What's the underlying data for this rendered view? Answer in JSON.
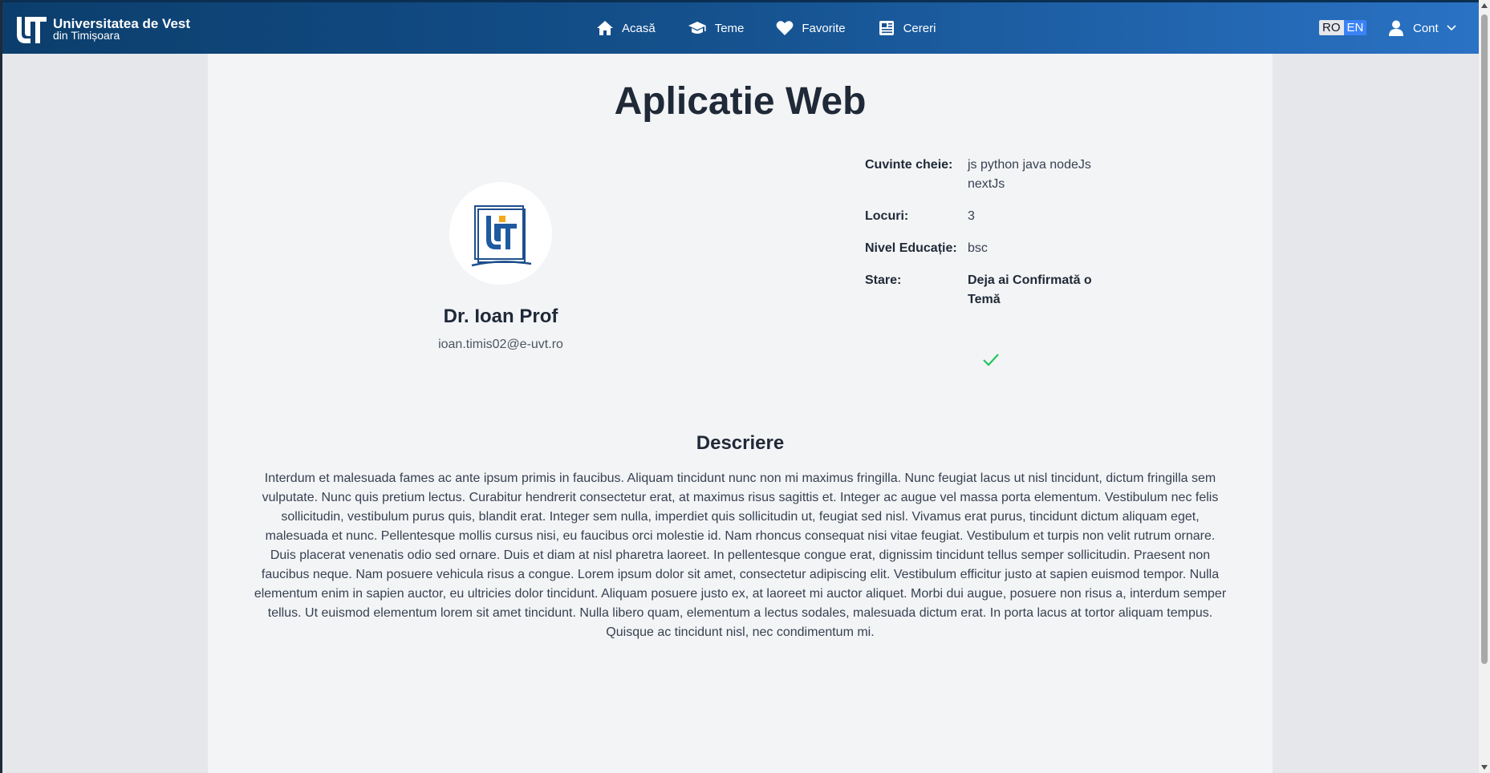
{
  "navbar": {
    "logo_line1": "Universitatea de Vest",
    "logo_line2": "din Timișoara",
    "items": [
      {
        "label": "Acasă",
        "icon": "home-icon"
      },
      {
        "label": "Teme",
        "icon": "graduation-cap-icon"
      },
      {
        "label": "Favorite",
        "icon": "heart-icon"
      },
      {
        "label": "Cereri",
        "icon": "newspaper-icon"
      }
    ],
    "lang_ro": "RO",
    "lang_en": "EN",
    "account_label": "Cont"
  },
  "topic": {
    "title": "Aplicatie Web",
    "professor_name": "Dr. Ioan Prof",
    "professor_email": "ioan.timis02@e-uvt.ro",
    "details": [
      {
        "label": "Cuvinte cheie:",
        "value": "js python java nodeJs nextJs"
      },
      {
        "label": "Locuri:",
        "value": "3"
      },
      {
        "label": "Nivel Educație:",
        "value": "bsc"
      },
      {
        "label": "Stare:",
        "value": "Deja ai Confirmată o Temă"
      }
    ],
    "description_title": "Descriere",
    "description": "Interdum et malesuada fames ac ante ipsum primis in faucibus. Aliquam tincidunt nunc non mi maximus fringilla. Nunc feugiat lacus ut nisl tincidunt, dictum fringilla sem vulputate. Nunc quis pretium lectus. Curabitur hendrerit consectetur erat, at maximus risus sagittis et. Integer ac augue vel massa porta elementum. Vestibulum nec felis sollicitudin, vestibulum purus quis, blandit erat. Integer sem nulla, imperdiet quis sollicitudin ut, feugiat sed nisl. Vivamus erat purus, tincidunt dictum aliquam eget, malesuada et nunc. Pellentesque mollis cursus nisi, eu faucibus orci molestie id. Nam rhoncus consequat nisi vitae feugiat. Vestibulum et turpis non velit rutrum ornare. Duis placerat venenatis odio sed ornare. Duis et diam at nisl pharetra laoreet. In pellentesque congue erat, dignissim tincidunt tellus semper sollicitudin. Praesent non faucibus neque. Nam posuere vehicula risus a congue. Lorem ipsum dolor sit amet, consectetur adipiscing elit. Vestibulum efficitur justo at sapien euismod tempor. Nulla elementum enim in sapien auctor, eu ultricies dolor tincidunt. Aliquam posuere justo ex, at laoreet mi auctor aliquet. Morbi dui augue, posuere non risus a, interdum semper tellus. Ut euismod elementum lorem sit amet tincidunt. Nulla libero quam, elementum a lectus sodales, malesuada dictum erat. In porta lacus at tortor aliquam tempus. Quisque ac tincidunt nisl, nec condimentum mi."
  },
  "colors": {
    "navbar_start": "#0b3e6c",
    "navbar_end": "#2a72c4",
    "lang_active": "#3b82f6",
    "check": "#22c55e"
  }
}
